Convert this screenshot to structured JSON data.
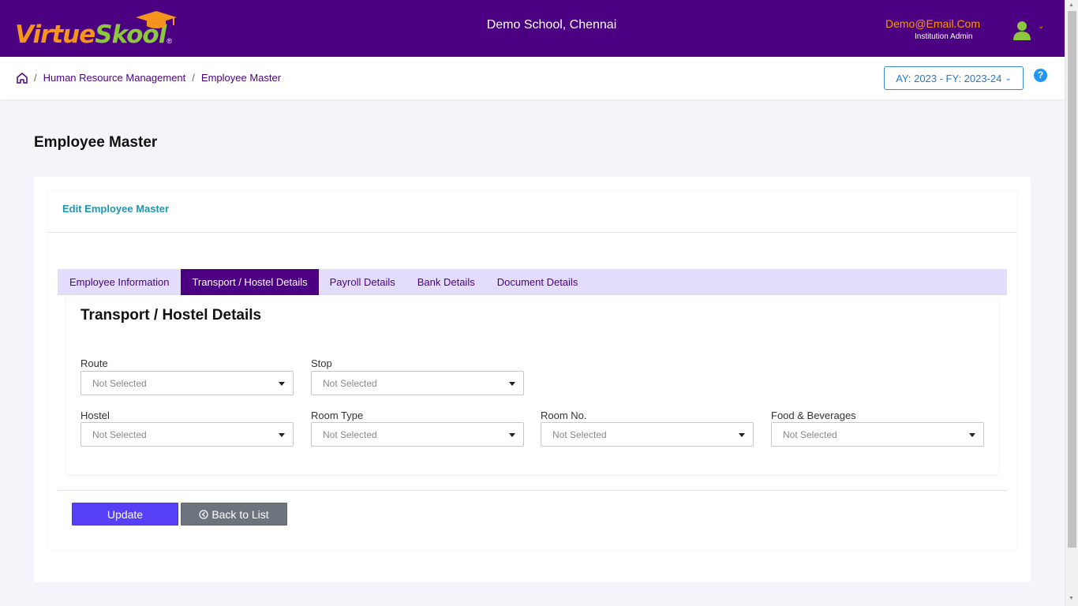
{
  "header": {
    "logo_virtue": "Virtue",
    "logo_skool": "Skool",
    "logo_reg": "®",
    "school_name": "Demo School, Chennai",
    "user_email": "Demo@Email.Com",
    "user_role": "Institution Admin",
    "user_chevron": "⌄"
  },
  "breadcrumb": {
    "items": [
      "Human Resource Management",
      "Employee Master"
    ],
    "separator": "/"
  },
  "academic_year": {
    "label": "AY: 2023 - FY: 2023-24",
    "chevron": "⌄"
  },
  "help": {
    "label": "?"
  },
  "page": {
    "title": "Employee Master",
    "card_title": "Edit Employee Master"
  },
  "tabs": [
    {
      "label": "Employee Information",
      "active": false
    },
    {
      "label": "Transport / Hostel Details",
      "active": true
    },
    {
      "label": "Payroll Details",
      "active": false
    },
    {
      "label": "Bank Details",
      "active": false
    },
    {
      "label": "Document Details",
      "active": false
    }
  ],
  "panel": {
    "title": "Transport / Hostel Details",
    "fields": {
      "route": {
        "label": "Route",
        "value": "Not Selected"
      },
      "stop": {
        "label": "Stop",
        "value": "Not Selected"
      },
      "hostel": {
        "label": "Hostel",
        "value": "Not Selected"
      },
      "room_type": {
        "label": "Room Type",
        "value": "Not Selected"
      },
      "room_no": {
        "label": "Room No.",
        "value": "Not Selected"
      },
      "food": {
        "label": "Food & Beverages",
        "value": "Not Selected"
      }
    }
  },
  "actions": {
    "update": "Update",
    "back_icon": "⊙",
    "back": "Back to List"
  },
  "colors": {
    "brand": "#4b0082",
    "accent_orange": "#f7941d",
    "accent_green": "#8dc63f",
    "update_button": "#5540f5",
    "back_button": "#6c757d",
    "card_title": "#1c96b0"
  },
  "icons": {
    "home": "home-icon",
    "user": "user-avatar-icon",
    "help": "help-icon",
    "caret": "caret-down-icon",
    "back": "arrow-circle-left-icon"
  }
}
